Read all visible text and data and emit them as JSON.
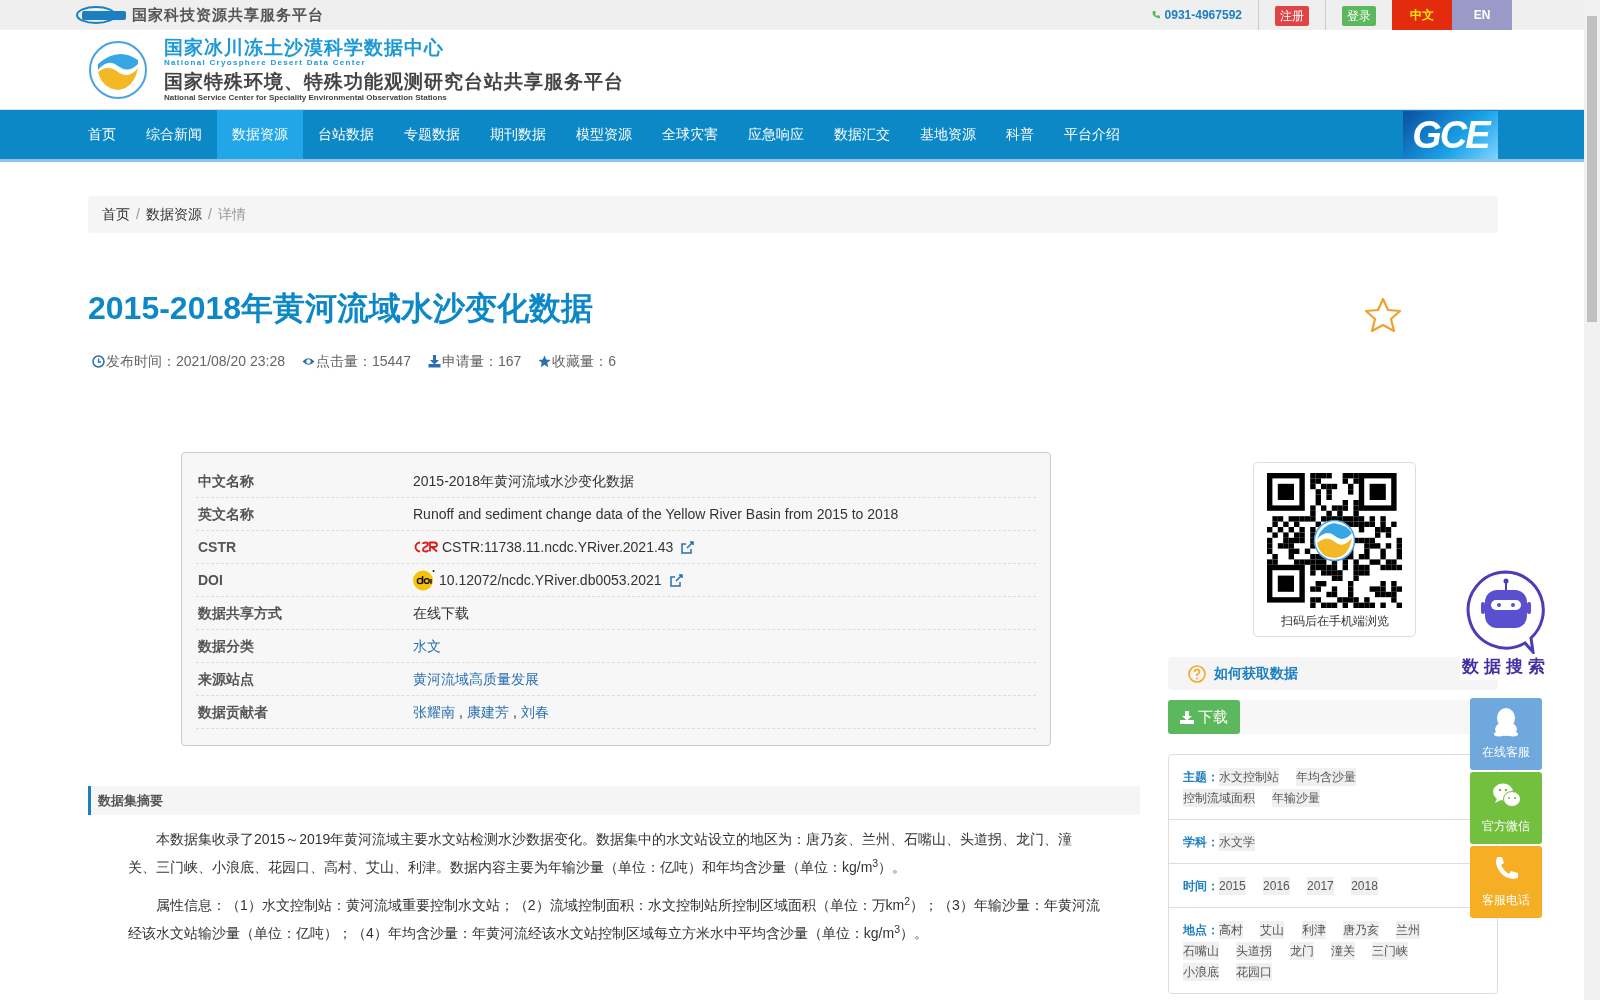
{
  "top_bar": {
    "site_name": "国家科技资源共享服务平台",
    "phone": "0931-4967592",
    "buttons": [
      {
        "label": "注册",
        "kind": "register"
      },
      {
        "label": "登录",
        "kind": "login"
      }
    ],
    "languages": [
      {
        "label": "中文",
        "selected": true
      },
      {
        "label": "EN",
        "selected": false
      }
    ]
  },
  "header": {
    "title": "国家冰川冻土沙漠科学数据中心",
    "title_en": "National Cryosphere Desert Data Center",
    "subtitle": "国家特殊环境、特殊功能观测研究台站共享服务平台",
    "subtitle_en": "National Service Center for Speciality Environmental Observation Stations"
  },
  "nav": {
    "items": [
      {
        "label": "首页",
        "selected": false
      },
      {
        "label": "综合新闻",
        "selected": false
      },
      {
        "label": "数据资源",
        "selected": true
      },
      {
        "label": "台站数据",
        "selected": false
      },
      {
        "label": "专题数据",
        "selected": false
      },
      {
        "label": "期刊数据",
        "selected": false
      },
      {
        "label": "模型资源",
        "selected": false
      },
      {
        "label": "全球灾害",
        "selected": false
      },
      {
        "label": "应急响应",
        "selected": false
      },
      {
        "label": "数据汇交",
        "selected": false
      },
      {
        "label": "基地资源",
        "selected": false
      },
      {
        "label": "科普",
        "selected": false
      },
      {
        "label": "平台介绍",
        "selected": false
      }
    ],
    "logo": "GCE"
  },
  "breadcrumb": [
    "首页",
    "数据资源",
    "详情"
  ],
  "breadcrumb_separator": "/",
  "dataset": {
    "title": "2015-2018年黄河流域水沙变化数据",
    "stats": [
      {
        "kind": "time",
        "label": "发布时间：",
        "value": "2021/08/20 23:28"
      },
      {
        "kind": "views",
        "label": "点击量：",
        "value": "15447"
      },
      {
        "kind": "requests",
        "label": "申请量：",
        "value": "167"
      },
      {
        "kind": "favorites",
        "label": "收藏量：",
        "value": "6"
      }
    ],
    "info": [
      {
        "label": "中文名称",
        "kind": "text",
        "value": "2015-2018年黄河流域水沙变化数据"
      },
      {
        "label": "英文名称",
        "kind": "text",
        "value": "Runoff and sediment change data of the Yellow River Basin from 2015 to 2018"
      },
      {
        "label": "CSTR",
        "kind": "cstr",
        "value": "CSTR:11738.11.ncdc.YRiver.2021.43"
      },
      {
        "label": "DOI",
        "kind": "doi",
        "value": "10.12072/ncdc.YRiver.db0053.2021"
      },
      {
        "label": "数据共享方式",
        "kind": "text",
        "value": "在线下载"
      },
      {
        "label": "数据分类",
        "kind": "link",
        "value": "水文"
      },
      {
        "label": "来源站点",
        "kind": "link",
        "value": "黄河流域高质量发展"
      },
      {
        "label": "数据贡献者",
        "kind": "links",
        "links": [
          "张耀南",
          "康建芳",
          "刘春"
        ],
        "separator": ","
      }
    ]
  },
  "abstract": {
    "heading": "数据集摘要",
    "paragraphs": [
      "本数据集收录了2015～2019年黄河流域主要水文站检测水沙数据变化。数据集中的水文站设立的地区为：唐乃亥、兰州、石嘴山、头道拐、龙门、潼关、三门峡、小浪底、花园口、高村、艾山、利津。数据内容主要为年输沙量（单位：亿吨）和年均含沙量（单位：kg/m$^{3}$）。",
      "属性信息：（1）水文控制站：黄河流域重要控制水文站；（2）流域控制面积：水文控制站所控制区域面积（单位：万km$^{2}$）；（3）年输沙量：年黄河流经该水文站输沙量（单位：亿吨）；（4）年均含沙量：年黄河流经该水文站控制区域每立方米水中平均含沙量（单位：kg/m$^{3}$）。"
    ]
  },
  "sidebar": {
    "qr_caption": "扫码后在手机端浏览",
    "how_to": "如何获取数据",
    "download": "下载",
    "facets": [
      {
        "label": "主题：",
        "tags": [
          "水文控制站",
          "年均含沙量",
          "控制流域面积",
          "年输沙量"
        ]
      },
      {
        "label": "学科：",
        "tags": [
          "水文学"
        ]
      },
      {
        "label": "时间：",
        "tags": [
          "2015",
          "2016",
          "2017",
          "2018"
        ]
      },
      {
        "label": "地点：",
        "tags": [
          "高村",
          "艾山",
          "利津",
          "唐乃亥",
          "兰州",
          "石嘴山",
          "头道拐",
          "龙门",
          "潼关",
          "三门峡",
          "小浪底",
          "花园口"
        ]
      }
    ]
  },
  "floating": {
    "robot_label": "数据搜索",
    "contacts": [
      {
        "label": "在线客服",
        "kind": "qq",
        "color": "#6fa8dc"
      },
      {
        "label": "官方微信",
        "kind": "wechat",
        "color": "#72c03e"
      },
      {
        "label": "客服电话",
        "kind": "phone",
        "color": "#f6ae24"
      }
    ]
  }
}
